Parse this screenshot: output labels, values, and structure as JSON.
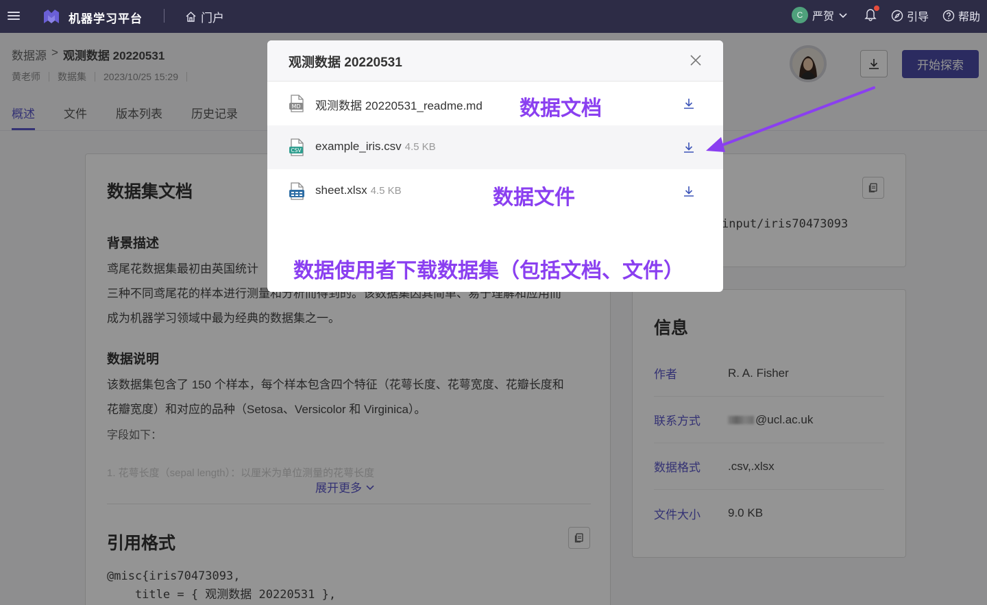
{
  "topbar": {
    "brand": "机器学习平台",
    "portal": "门户",
    "user_initial": "C",
    "user_name": "严贺",
    "guide": "引导",
    "help": "帮助"
  },
  "header": {
    "breadcrumb_root": "数据源",
    "breadcrumb_sep": ">",
    "breadcrumb_current": "观测数据 20220531",
    "meta": [
      "黄老师",
      "数据集",
      "2023/10/25 15:29"
    ],
    "explore_button": "开始探索"
  },
  "tabs": [
    {
      "label": "概述",
      "active": true
    },
    {
      "label": "文件"
    },
    {
      "label": "版本列表"
    },
    {
      "label": "历史记录"
    }
  ],
  "doc": {
    "title": "数据集文档",
    "bg_heading": "背景描述",
    "bg_text": [
      "鸢尾花数据集最初由英国统计",
      "三种不同鸢尾花的样本进行测量和分析而得到的。该数据集因其简单、易于理解和应用而",
      "成为机器学习领域中最为经典的数据集之一。"
    ],
    "data_heading": "数据说明",
    "data_text": [
      "该数据集包含了 150 个样本，每个样本包含四个特征（花萼长度、花萼宽度、花瓣长度和",
      "花瓣宽度）和对应的品种（Setosa、Versicolor 和 Virginica）。"
    ],
    "fields_label": "字段如下：",
    "faded_line": "1. 花萼长度（sepal length）：以厘米为单位测量的花萼长度",
    "expand": "展开更多"
  },
  "citation": {
    "title": "引用格式",
    "code": "@misc{iris70473093,\n    title = { 观测数据 20220531 },"
  },
  "side": {
    "path": "input/iris70473093"
  },
  "info": {
    "title": "信息",
    "rows": [
      {
        "key": "作者",
        "value": "R. A. Fisher"
      },
      {
        "key": "联系方式",
        "value": "@ucl.ac.uk"
      },
      {
        "key": "数据格式",
        "value": ".csv,.xlsx"
      },
      {
        "key": "文件大小",
        "value": "9.0 KB"
      }
    ]
  },
  "modal": {
    "title": "观测数据 20220531",
    "files": [
      {
        "name": "观测数据 20220531_readme.md",
        "size": "",
        "icon": "md-file-icon"
      },
      {
        "name": "example_iris.csv",
        "size": "4.5 KB",
        "icon": "csv-file-icon"
      },
      {
        "name": "sheet.xlsx",
        "size": "4.5 KB",
        "icon": "xlsx-file-icon"
      }
    ]
  },
  "annotations": {
    "doc": "数据文档",
    "file": "数据文件",
    "caption": "数据使用者下载数据集（包括文档、文件）",
    "color": "#8a3ff0"
  }
}
